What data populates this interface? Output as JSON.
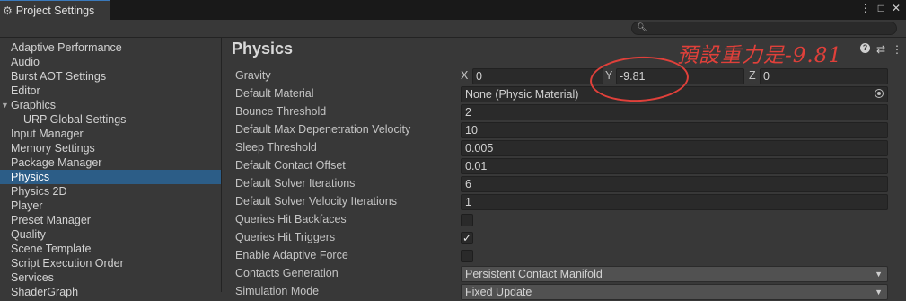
{
  "window": {
    "tab_title": "Project Settings",
    "buttons": [
      "⋮",
      "□",
      "✕"
    ]
  },
  "sidebar": {
    "items": [
      {
        "label": "Adaptive Performance"
      },
      {
        "label": "Audio"
      },
      {
        "label": "Burst AOT Settings"
      },
      {
        "label": "Editor"
      },
      {
        "label": "Graphics"
      },
      {
        "label": "URP Global Settings"
      },
      {
        "label": "Input Manager"
      },
      {
        "label": "Memory Settings"
      },
      {
        "label": "Package Manager"
      },
      {
        "label": "Physics"
      },
      {
        "label": "Physics 2D"
      },
      {
        "label": "Player"
      },
      {
        "label": "Preset Manager"
      },
      {
        "label": "Quality"
      },
      {
        "label": "Scene Template"
      },
      {
        "label": "Script Execution Order"
      },
      {
        "label": "Services"
      },
      {
        "label": "ShaderGraph"
      }
    ],
    "selected": "Physics"
  },
  "main": {
    "title": "Physics",
    "header_icons": [
      "?",
      "⇄",
      "⋮"
    ],
    "gravity": {
      "label": "Gravity",
      "x_axis": "X",
      "x": "0",
      "y_axis": "Y",
      "y": "-9.81",
      "z_axis": "Z",
      "z": "0"
    },
    "default_material": {
      "label": "Default Material",
      "value": "None (Physic Material)"
    },
    "bounce_threshold": {
      "label": "Bounce Threshold",
      "value": "2"
    },
    "max_depenetration": {
      "label": "Default Max Depenetration Velocity",
      "value": "10"
    },
    "sleep_threshold": {
      "label": "Sleep Threshold",
      "value": "0.005"
    },
    "contact_offset": {
      "label": "Default Contact Offset",
      "value": "0.01"
    },
    "solver_iterations": {
      "label": "Default Solver Iterations",
      "value": "6"
    },
    "solver_velocity_iterations": {
      "label": "Default Solver Velocity Iterations",
      "value": "1"
    },
    "queries_hit_backfaces": {
      "label": "Queries Hit Backfaces",
      "checked": false
    },
    "queries_hit_triggers": {
      "label": "Queries Hit Triggers",
      "checked": true
    },
    "enable_adaptive_force": {
      "label": "Enable Adaptive Force",
      "checked": false
    },
    "contacts_generation": {
      "label": "Contacts Generation",
      "value": "Persistent Contact Manifold"
    },
    "simulation_mode": {
      "label": "Simulation Mode",
      "value": "Fixed Update"
    }
  },
  "annotation": {
    "text": "預設重力是-9.81",
    "color": "#e0403a"
  },
  "colors": {
    "selection": "#2c5d87",
    "background": "#383838",
    "field": "#2a2a2a"
  }
}
